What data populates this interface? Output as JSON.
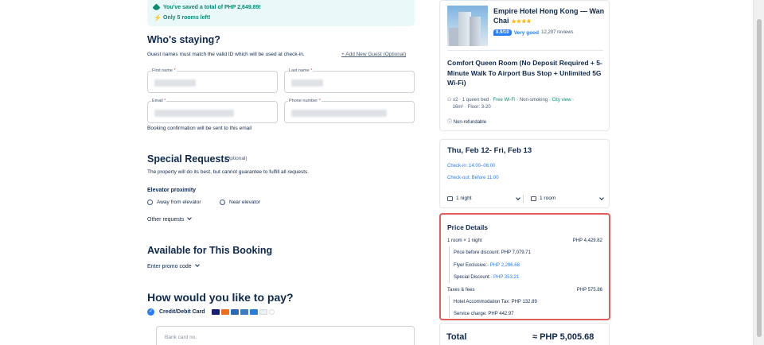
{
  "savings": {
    "saved_text": "You've saved a total of PHP 2,649.89!",
    "rooms_left": "Only 5 rooms left!"
  },
  "guest": {
    "heading": "Who's staying?",
    "note": "Guest names must match the valid ID which will be used at check-in.",
    "add_guest": "+ Add New Guest (Optional)",
    "first_name_label": "First name",
    "last_name_label": "Last name",
    "email_label": "Email",
    "phone_label": "Phone number",
    "required_mark": "*",
    "confirmation_note": "Booking confirmation will be sent to this email"
  },
  "requests": {
    "heading": "Special Requests",
    "optional": "(Optional)",
    "note": "The property will do its best, but cannot guarantee to fulfill all requests.",
    "elevator_label": "Elevator proximity",
    "option_away": "Away from elevator",
    "option_near": "Near elevator",
    "other_requests": "Other requests"
  },
  "promo": {
    "heading": "Available for This Booking",
    "enter_code": "Enter promo code"
  },
  "payment": {
    "heading": "How would you like to pay?",
    "method": "Credit/Debit Card",
    "card_placeholder": "Bank card no."
  },
  "hotel": {
    "name": "Empire Hotel Hong Kong — Wan Chai",
    "stars": "★★★★",
    "score": "8.9/10",
    "rating_text": "Very good",
    "reviews": "12,297 reviews",
    "room_title": "Comfort Queen Room (No Deposit Required + 5-Minute Walk To Airport Bus Stop + Unlimited 5G Wi-Fi)",
    "guests": "x2",
    "bed": "1 queen bed",
    "wifi": "Free Wi-Fi",
    "smoking": "Non-smoking",
    "view": "City view",
    "size": "16m²",
    "floor": "Floor: 3-20",
    "refund": "Non-refundable"
  },
  "stay": {
    "dates": "Thu, Feb 12- Fri, Feb 13",
    "check_in": "Check-in: 14:00–06:00",
    "check_out": "Check-out: Before 11:00",
    "nights": "1 night",
    "rooms": "1 room"
  },
  "price": {
    "heading": "Price Details",
    "room_line": "1 room × 1 night",
    "room_amount": "PHP 4,429.82",
    "before_discount": "Price before discount: PHP 7,079.71",
    "flyer_label": "Flyer Exclusive:",
    "flyer_amount": "- PHP 2,296.68",
    "special_label": "Special Discount:",
    "special_amount": "- PHP 353.21",
    "taxes_label": "Taxes & fees",
    "taxes_amount": "PHP 575.86",
    "accom_tax": "Hotel Accommodation Tax: PHP 132.89",
    "service_charge": "Service charge: PHP 442.97",
    "total_label": "Total",
    "total_amount": "≈ PHP 5,005.68"
  },
  "colors": {
    "accent": "#287dfa",
    "success": "#0a8a73",
    "highlight_border": "#e25c5c",
    "text": "#0f294d"
  }
}
